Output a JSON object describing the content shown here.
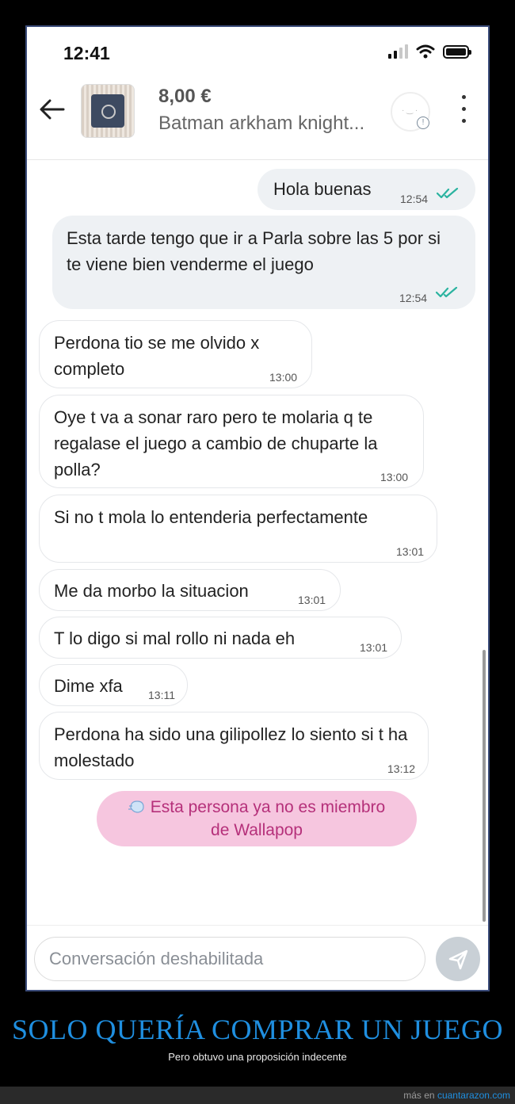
{
  "status_bar": {
    "time": "12:41"
  },
  "header": {
    "price": "8,00 €",
    "title": "Batman arkham knight...",
    "seller_info_icon": "info-icon"
  },
  "messages": [
    {
      "dir": "out",
      "text": "Hola buenas",
      "time": "12:54",
      "read": true
    },
    {
      "dir": "out",
      "text": "Esta tarde tengo que ir a Parla sobre las 5 por si te viene bien venderme el juego",
      "time": "12:54",
      "read": true
    },
    {
      "dir": "in",
      "text": "Perdona tio se me olvido x completo",
      "time": "13:00"
    },
    {
      "dir": "in",
      "text": "Oye t va a sonar raro pero te molaria q te regalase el juego a cambio de chuparte la polla?",
      "time": "13:00"
    },
    {
      "dir": "in",
      "text": "Si no t mola lo entenderia perfectamente",
      "time": "13:01"
    },
    {
      "dir": "in",
      "text": "Me da morbo la situacion",
      "time": "13:01"
    },
    {
      "dir": "in",
      "text": "T lo digo si  mal rollo ni nada eh",
      "time": "13:01"
    },
    {
      "dir": "in",
      "text": "Dime xfa",
      "time": "13:11"
    },
    {
      "dir": "in",
      "text": "Perdona ha sido una gilipollez lo siento si t ha molestado",
      "time": "13:12"
    }
  ],
  "banner": {
    "line1": "Esta persona ya no es miembro",
    "line2": "de Wallapop",
    "icon": "ghost-icon"
  },
  "input": {
    "placeholder": "Conversación deshabilitada"
  },
  "caption": {
    "title": "SOLO QUERÍA COMPRAR UN JUEGO",
    "subtitle": "Pero obtuvo una proposición indecente",
    "more_prefix": "más en",
    "site": "cuantarazon.com"
  },
  "colors": {
    "read_ticks": "#2bb3a0",
    "banner_bg": "#f6c6df",
    "banner_text": "#b5307a",
    "caption": "#1f8fe0"
  }
}
